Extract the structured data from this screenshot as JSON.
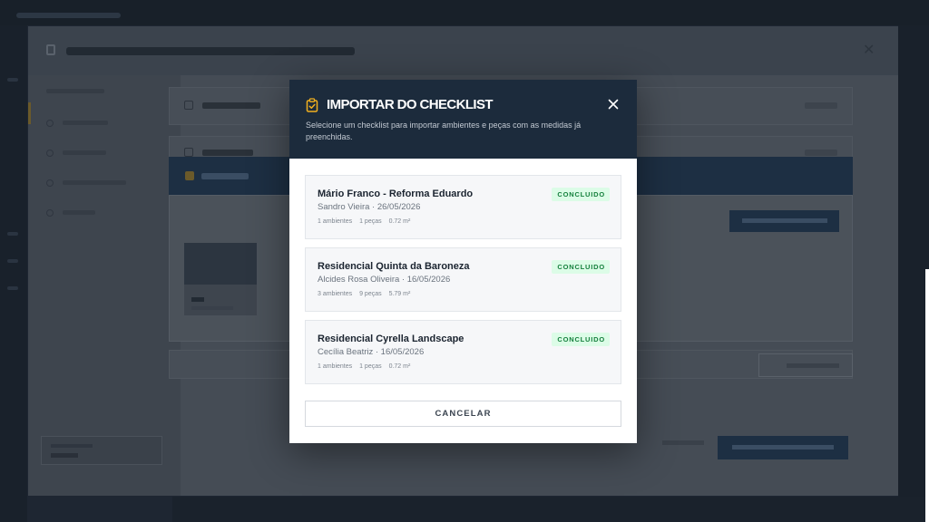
{
  "dialog": {
    "title": "IMPORTAR DO CHECKLIST",
    "subtitle": "Selecione um checklist para importar ambientes e peças com as medidas já preenchidas.",
    "icon": "clipboard-check-icon",
    "close_icon": "close-icon",
    "accent_color": "#f2b01e",
    "header_color": "#1c2b3c",
    "cancel_label": "CANCELAR"
  },
  "checklists": [
    {
      "title": "Mário Franco - Reforma Eduardo",
      "meta": "Sandro Vieira · 26/05/2026",
      "status": "CONCLUIDO",
      "ambientes": "1 ambientes",
      "pecas": "1 peças",
      "area": "0.72 m²"
    },
    {
      "title": "Residencial Quinta da Baroneza",
      "meta": "Alcides Rosa Oliveira · 16/05/2026",
      "status": "CONCLUIDO",
      "ambientes": "3 ambientes",
      "pecas": "9 peças",
      "area": "5.79 m²"
    },
    {
      "title": "Residencial Cyrella Landscape",
      "meta": "Cecília Beatriz · 16/05/2026",
      "status": "CONCLUIDO",
      "ambientes": "1 ambientes",
      "pecas": "1 peças",
      "area": "0.72 m²"
    }
  ],
  "status_colors": {
    "badge_bg": "#dcfce7",
    "badge_text": "#15803d"
  }
}
